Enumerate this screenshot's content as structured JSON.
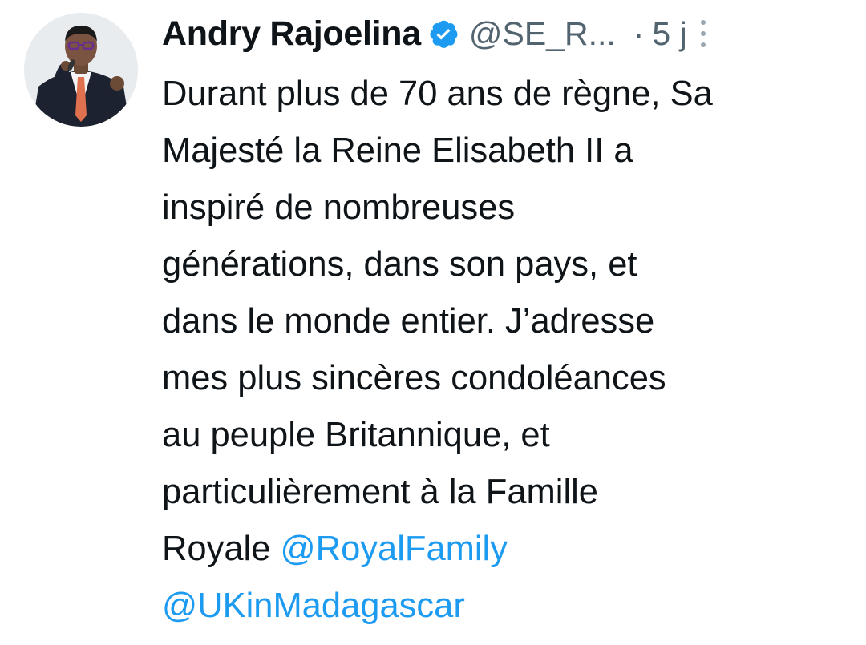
{
  "tweet": {
    "author_name": "Andry Rajoelina",
    "handle": "@SE_R...",
    "separator": "·",
    "time": "5 j",
    "body_lines": [
      "Durant plus de 70 ans de règne, Sa",
      "Majesté la Reine Elisabeth II a",
      "inspiré de nombreuses",
      "générations, dans son pays, et",
      "dans le monde entier. J’adresse",
      "mes plus sincères condoléances",
      "au peuple Britannique, et",
      "particulièrement à la Famille",
      "Royale "
    ],
    "mentions": [
      "@RoyalFamily",
      "@UKinMadagascar"
    ]
  },
  "icons": {
    "verified": "verified-badge-icon",
    "more": "more-options-icon"
  },
  "colors": {
    "text": "#0f1419",
    "secondary": "#536471",
    "accent": "#1d9bf0"
  }
}
